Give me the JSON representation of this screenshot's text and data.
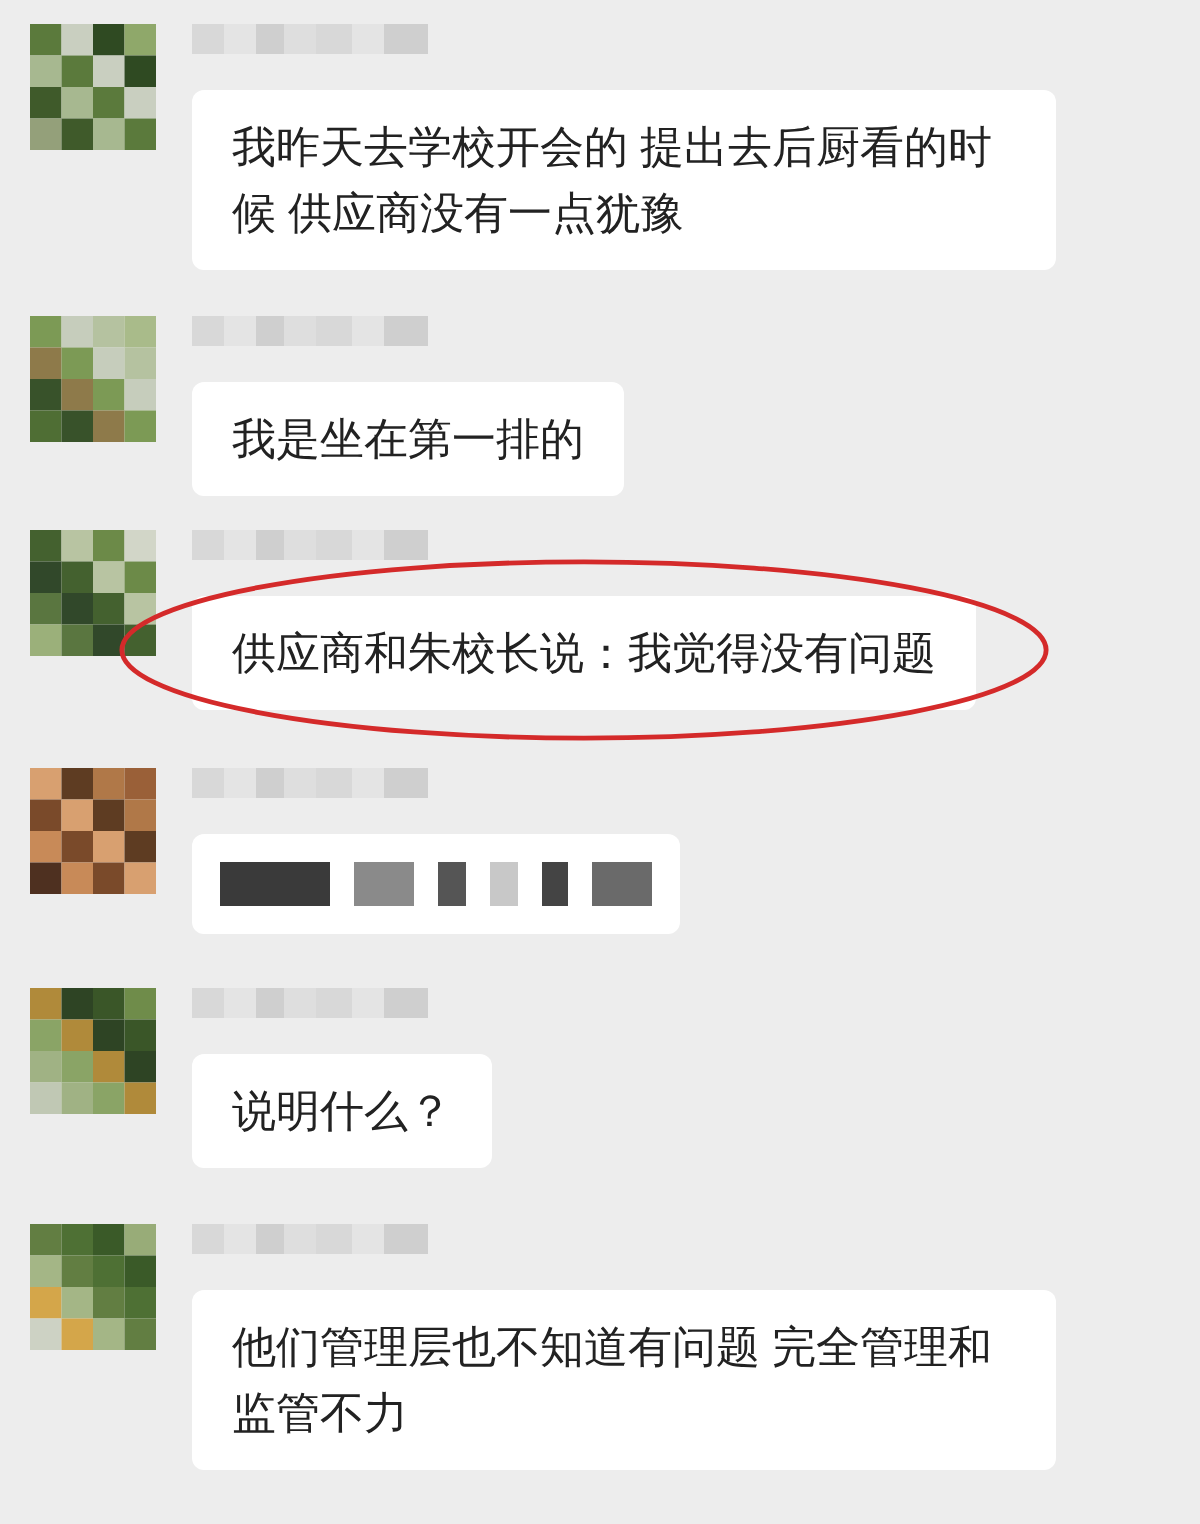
{
  "messages": [
    {
      "kind": "text",
      "text": "我昨天去学校开会的 提出去后厨看的时候 供应商没有一点犹豫",
      "circled": false
    },
    {
      "kind": "text",
      "text": "我是坐在第一排的",
      "circled": false
    },
    {
      "kind": "text",
      "text": "供应商和朱校长说：我觉得没有问题",
      "circled": true
    },
    {
      "kind": "redacted",
      "circled": false
    },
    {
      "kind": "text",
      "text": "说明什么？",
      "circled": false
    },
    {
      "kind": "text",
      "text": "他们管理层也不知道有问题 完全管理和监管不力",
      "circled": false
    }
  ]
}
